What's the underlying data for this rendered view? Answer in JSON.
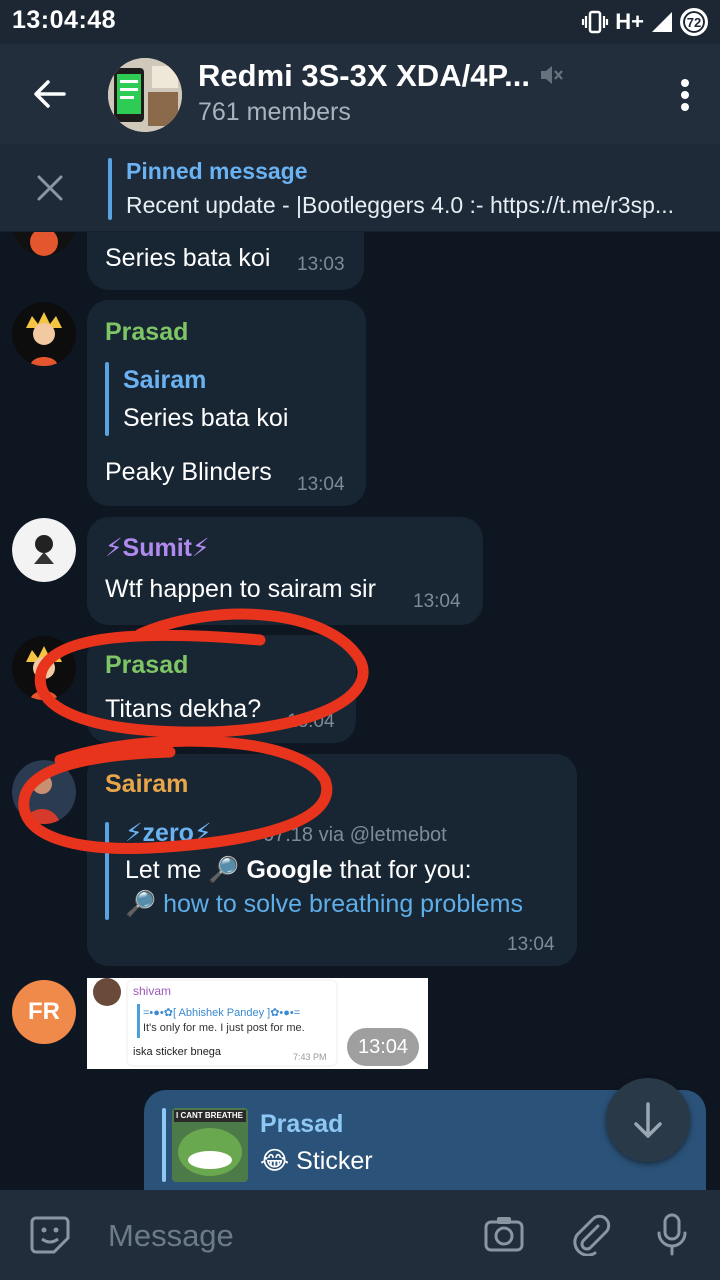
{
  "status_bar": {
    "time": "13:04:48",
    "network": "H+",
    "battery": "72"
  },
  "header": {
    "title": "Redmi 3S-3X XDA/4P...",
    "subtitle": "761 members"
  },
  "pinned": {
    "title": "Pinned message",
    "text": "Recent update - |Bootleggers 4.0 :- https://t.me/r3sp..."
  },
  "messages": [
    {
      "text": "Series bata koi",
      "time": "13:03"
    },
    {
      "sender": "Prasad",
      "reply_name": "Sairam",
      "reply_text": "Series bata koi",
      "text": "Peaky Blinders",
      "time": "13:04"
    },
    {
      "sender": "⚡Sumit⚡",
      "text": "Wtf happen to sairam sir",
      "time": "13:04"
    },
    {
      "sender": "Prasad",
      "text": "Titans dekha?",
      "time": "13:04"
    },
    {
      "sender": "Sairam",
      "forward_name": "⚡zero⚡",
      "forward_meta": "07.18 via @letmebot",
      "text_pre": "Let me 🔎 ",
      "text_bold": "Google",
      "text_post": " that for you:",
      "link_icon": "🔎 ",
      "link_text": "how to solve breathing problems",
      "time": "13:04"
    },
    {
      "avatar_initials": "FR",
      "time": "13:04",
      "image": {
        "name": "shivam",
        "reply_name": "=•●•✿[ Abhishek Pandey ]✿•●•=",
        "reply_text": "It's only for me. I just post for me.",
        "text": "iska sticker bnega",
        "time": "7:43 PM"
      }
    }
  ],
  "reply_preview": {
    "name": "Prasad",
    "text": "😂 Sticker",
    "sticker_label": "I CANT BREATHE"
  },
  "composer": {
    "placeholder": "Message"
  },
  "colors": {
    "accent": "#5aa3e0",
    "background": "#0e1621",
    "annotation": "#e8341c"
  }
}
